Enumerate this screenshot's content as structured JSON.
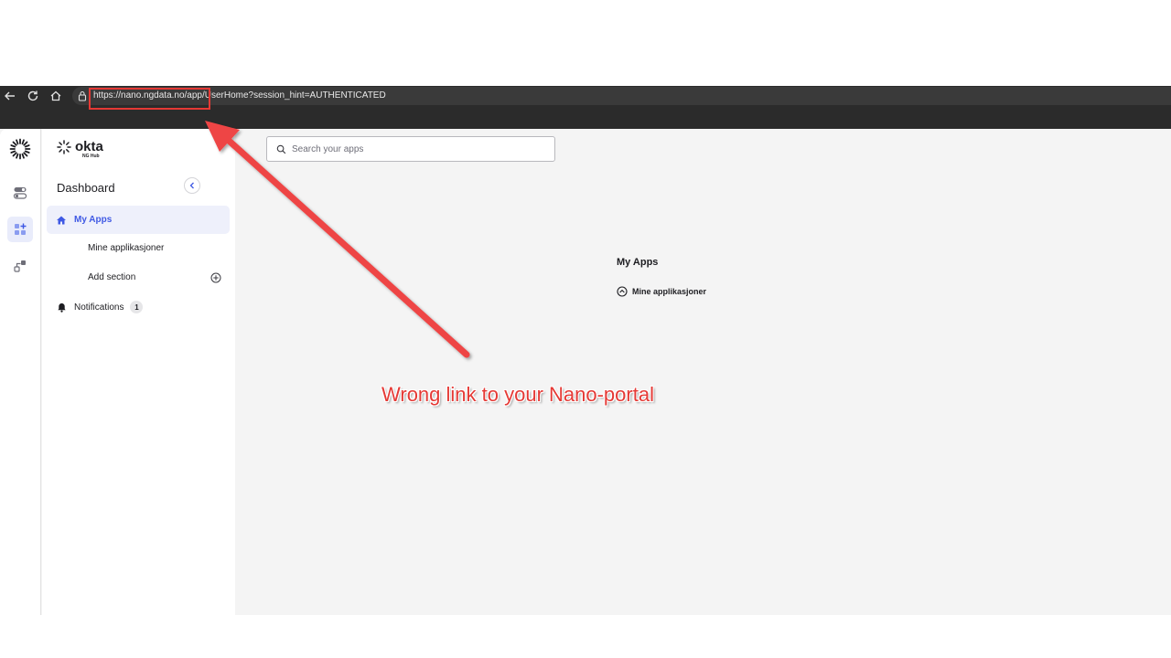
{
  "browser": {
    "url": "https://nano.ngdata.no/app/UserHome?session_hint=AUTHENTICATED",
    "highlighted_segment": "https://nano.ngdata.no/app/"
  },
  "rail": {
    "icons": [
      "okta-sunburst-icon",
      "toggle-icon",
      "apps-grid-icon",
      "integration-icon"
    ]
  },
  "sidebar": {
    "brand": "okta",
    "brand_sub": "NG Hub",
    "title": "Dashboard",
    "my_apps_label": "My Apps",
    "sub_item_label": "Mine applikasjoner",
    "add_section_label": "Add section",
    "notifications_label": "Notifications",
    "notifications_count": "1"
  },
  "main": {
    "search_placeholder": "Search your apps",
    "heading": "My Apps",
    "section_label": "Mine applikasjoner"
  },
  "annotation": {
    "text": "Wrong link to your Nano-portal",
    "color": "#e53935"
  },
  "colors": {
    "accent": "#3f59e4",
    "chrome": "#2b2b2b"
  }
}
